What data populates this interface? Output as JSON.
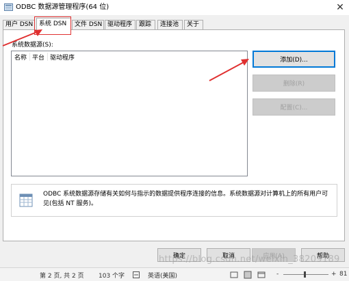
{
  "window": {
    "title": "ODBC 数据源管理程序(64 位)",
    "close_glyph": "✕"
  },
  "tabs": [
    {
      "label": "用户 DSN",
      "active": false
    },
    {
      "label": "系统 DSN",
      "active": true
    },
    {
      "label": "文件 DSN",
      "active": false
    },
    {
      "label": "驱动程序",
      "active": false
    },
    {
      "label": "跟踪",
      "active": false
    },
    {
      "label": "连接池",
      "active": false
    },
    {
      "label": "关于",
      "active": false
    }
  ],
  "system_dsn": {
    "list_label": "系统数据源(S):",
    "columns": [
      "名称",
      "平台",
      "驱动程序"
    ],
    "buttons": {
      "add": "添加(D)...",
      "remove": "删除(R)",
      "configure": "配置(C)..."
    },
    "info_text": "ODBC 系统数据源存储有关如何与指示的数据提供程序连接的信息。系统数据源对计算机上的所有用户可见(包括 NT 服务)。"
  },
  "footer_buttons": {
    "ok": "确定",
    "cancel": "取消",
    "apply": "应用(A)",
    "help": "帮助"
  },
  "statusbar": {
    "page": "第 2 页, 共 2 页",
    "words": "103 个字",
    "language": "英语(美国)",
    "zoom_minus": "-",
    "zoom_plus": "+",
    "zoom_value": "81"
  },
  "watermark": "https://blog.csdn.net/weixin_38209189",
  "colors": {
    "accent": "#0078d7",
    "annotation_red": "#e03030"
  }
}
